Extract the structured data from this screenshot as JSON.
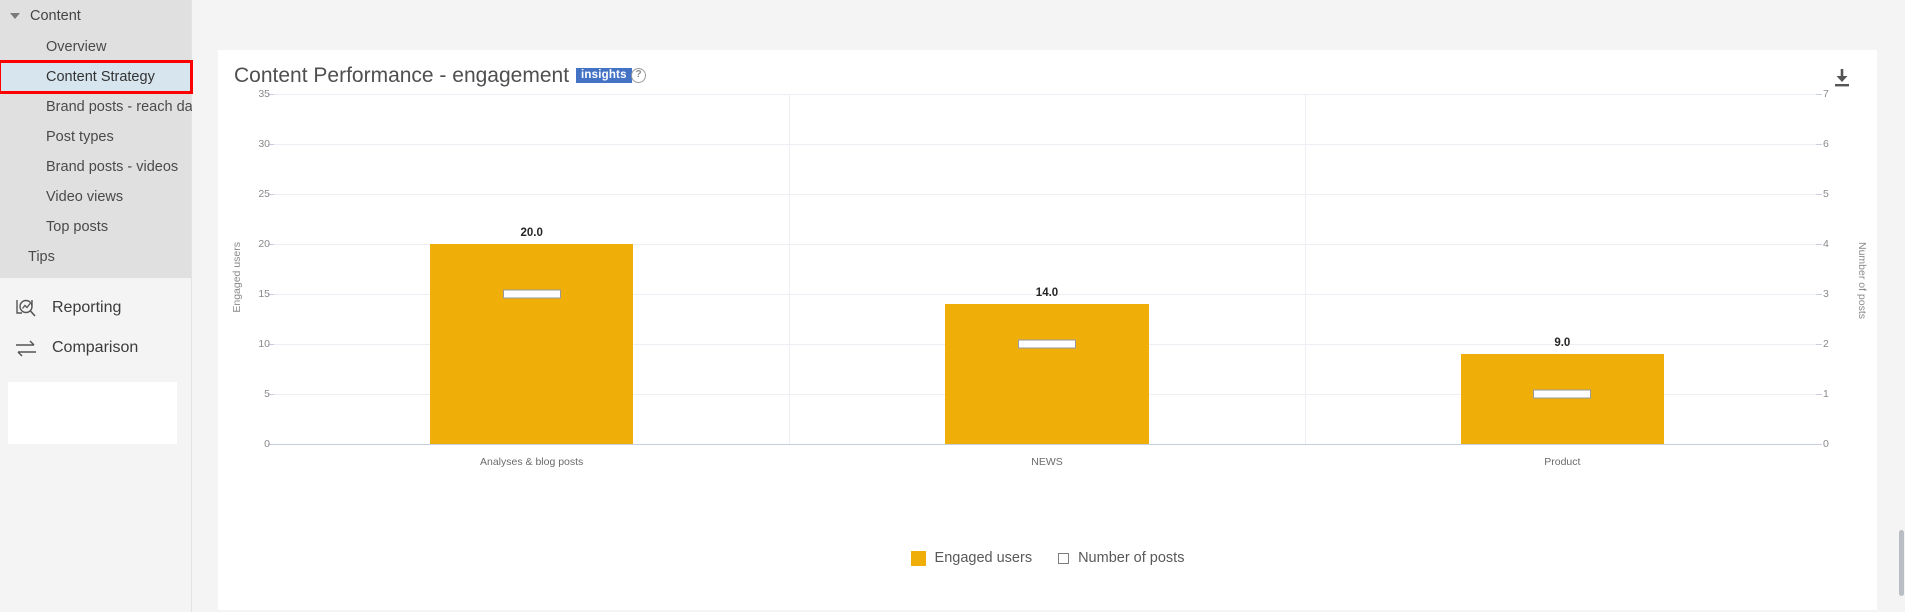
{
  "sidebar": {
    "group": {
      "label": "Content",
      "icon": "caret-down-icon",
      "expanded": true
    },
    "items": [
      {
        "label": "Overview",
        "selected": false
      },
      {
        "label": "Content Strategy",
        "selected": true
      },
      {
        "label": "Brand posts - reach data",
        "selected": false
      },
      {
        "label": "Post types",
        "selected": false
      },
      {
        "label": "Brand posts - videos",
        "selected": false
      },
      {
        "label": "Video views",
        "selected": false
      },
      {
        "label": "Top posts",
        "selected": false
      }
    ],
    "tips": {
      "label": "Tips"
    },
    "main_nav": [
      {
        "label": "Reporting",
        "icon": "reporting-magnifier-icon"
      },
      {
        "label": "Comparison",
        "icon": "comparison-arrows-icon"
      }
    ],
    "selected_highlight_color": "#ff0000",
    "selected_bg_color": "#d7e5ef"
  },
  "header": {
    "title": "Content Performance - engagement",
    "badge": "insights",
    "badge_color": "#4472c4",
    "help_icon": "question-mark-icon",
    "help_glyph": "?",
    "download_icon": "download-icon"
  },
  "legend": [
    {
      "label": "Engaged users",
      "style": "filled",
      "color": "#efae08"
    },
    {
      "label": "Number of posts",
      "style": "outline",
      "color": "#ffffff"
    }
  ],
  "chart_data": {
    "type": "bar",
    "title": "Content Performance - engagement",
    "categories": [
      "Analyses & blog posts",
      "NEWS",
      "Product"
    ],
    "series": [
      {
        "name": "Engaged users",
        "axis": "left",
        "values": [
          20.0,
          14.0,
          9.0
        ],
        "labels": [
          "20.0",
          "14.0",
          "9.0"
        ],
        "color": "#efae08"
      },
      {
        "name": "Number of posts",
        "axis": "right",
        "values": [
          3,
          2,
          1
        ],
        "color": "#ffffff"
      }
    ],
    "xlabel": "",
    "ylabel": "Engaged users",
    "y2label": "Number of posts",
    "ylim": [
      0,
      35
    ],
    "y2lim": [
      0,
      7
    ],
    "yticks": [
      "0",
      "5",
      "10",
      "15",
      "20",
      "25",
      "30",
      "35"
    ],
    "y2ticks": [
      "0",
      "1",
      "2",
      "3",
      "4",
      "5",
      "6",
      "7"
    ],
    "grid": true,
    "legend_position": "bottom"
  }
}
